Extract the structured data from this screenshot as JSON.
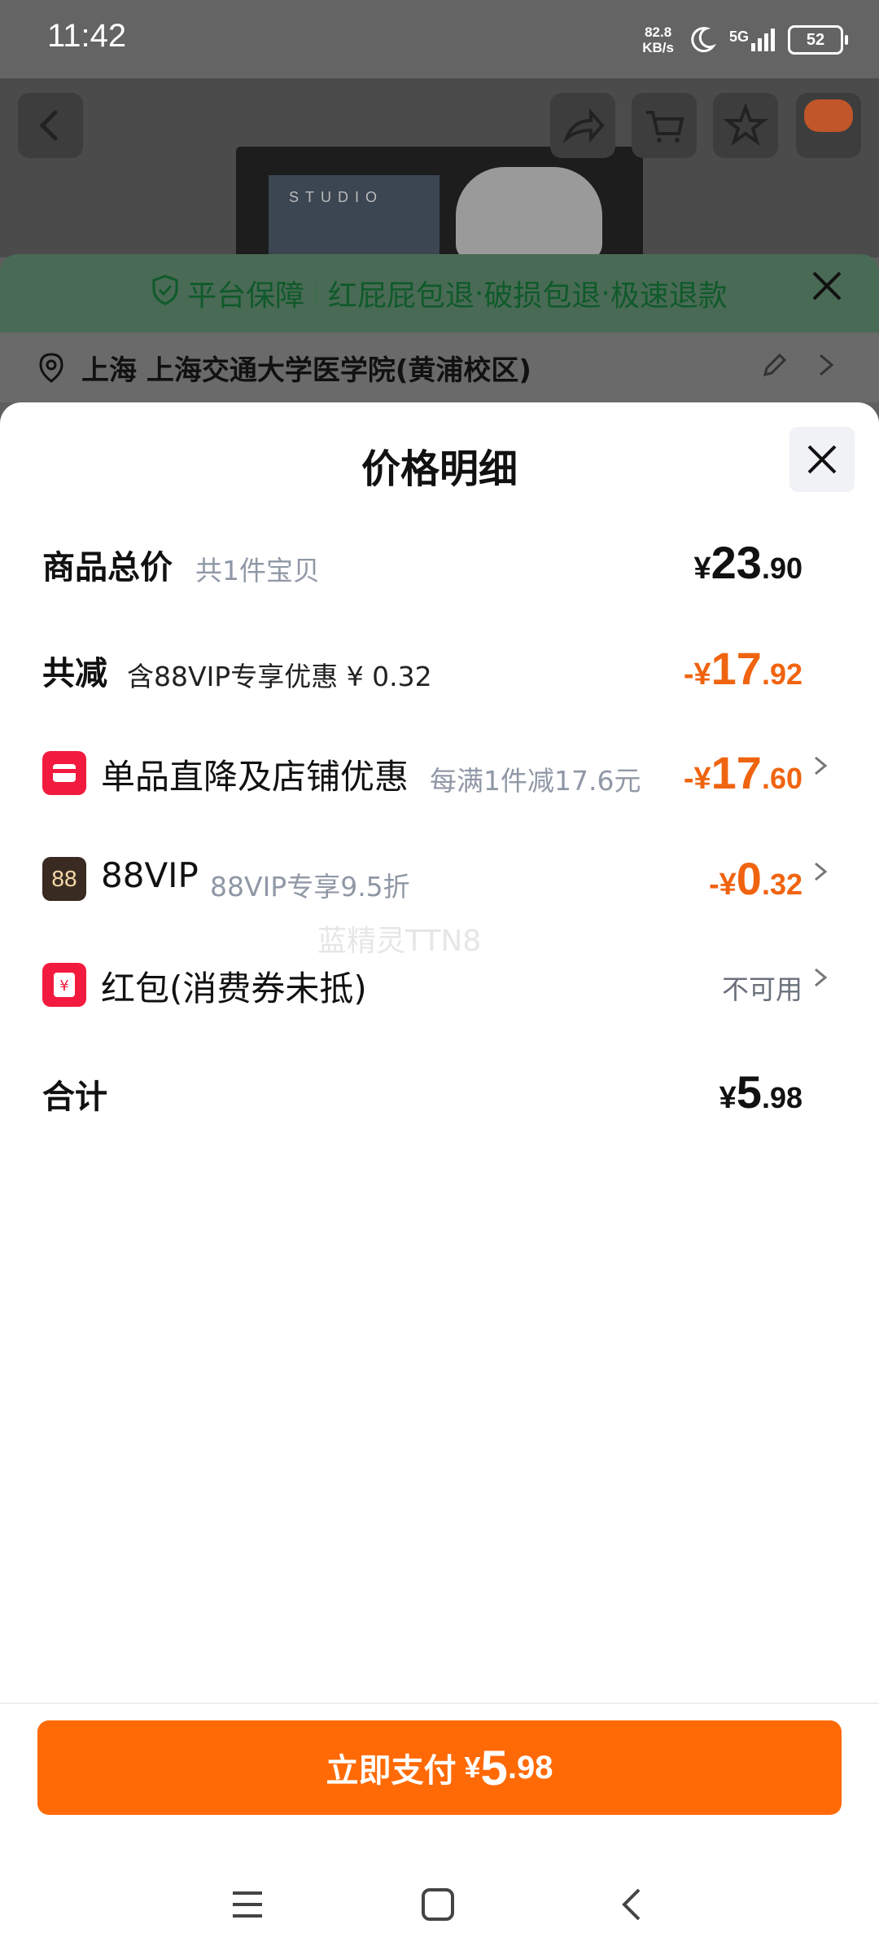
{
  "status": {
    "time": "11:42",
    "speed_value": "82.8",
    "speed_unit": "KB/s",
    "network": "5G",
    "battery": "52"
  },
  "guarantee": {
    "title": "平台保障",
    "items": [
      "红屁屁包退",
      "破损包退",
      "极速退款"
    ]
  },
  "address": {
    "text": "上海 上海交通大学医学院(黄浦校区)"
  },
  "sheet": {
    "title": "价格明细",
    "total": {
      "label": "商品总价",
      "sub": "共1件宝贝",
      "currency": "¥",
      "int": "23",
      "dec": ".90"
    },
    "reduction": {
      "label": "共减",
      "sub": "含88VIP专享优惠 ¥ 0.32",
      "currency": "-¥",
      "int": "17",
      "dec": ".92"
    },
    "shop_discount": {
      "label": "单品直降及店铺优惠",
      "sub": "每满1件减17.6元",
      "currency": "-¥",
      "int": "17",
      "dec": ".60"
    },
    "vip": {
      "badge": "88",
      "label": "88VIP",
      "sub": "88VIP专享9.5折",
      "currency": "-¥",
      "int": "0",
      "dec": ".32"
    },
    "red_packet": {
      "label": "红包(消费券未抵)",
      "status": "不可用"
    },
    "sum": {
      "label": "合计",
      "currency": "¥",
      "int": "5",
      "dec": ".98"
    },
    "watermark": "蓝精灵TTN8"
  },
  "pay": {
    "label": "立即支付",
    "currency": "¥",
    "int": "5",
    "dec": ".98"
  },
  "colors": {
    "accent": "#ff6a06",
    "discount": "#f06410",
    "guarantee": "#0f5a2a"
  }
}
